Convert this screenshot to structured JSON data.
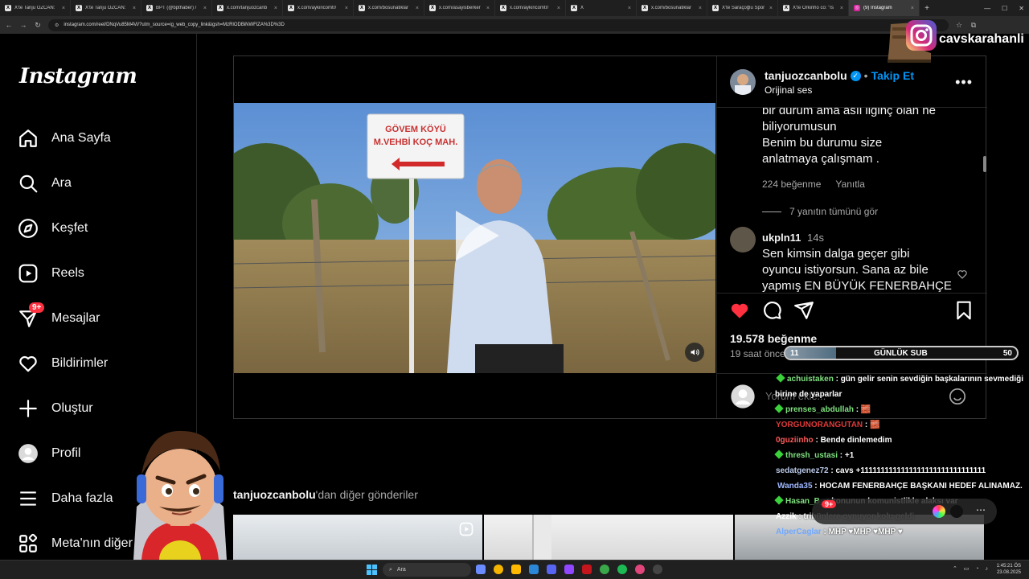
{
  "browser": {
    "tabs": [
      {
        "label": "X'te Tanju ÖZCAN:",
        "icon": "x-logo-icon"
      },
      {
        "label": "X'te Tanju ÖZCAN:",
        "icon": "x-logo-icon"
      },
      {
        "label": "BPT (@bpthaber) /",
        "icon": "x-logo-icon"
      },
      {
        "label": "x.com/tanjuozcanb",
        "icon": "x-logo-icon"
      },
      {
        "label": "x.com/aykiricomtr/",
        "icon": "x-logo-icon"
      },
      {
        "label": "x.com/bosunatiklar",
        "icon": "x-logo-icon"
      },
      {
        "label": "x.com/asayisberker",
        "icon": "x-logo-icon"
      },
      {
        "label": "x.com/aykiricomtr/",
        "icon": "x-logo-icon"
      },
      {
        "label": "X",
        "icon": "x-logo-icon"
      },
      {
        "label": "x.com/bosunatiklar",
        "icon": "x-logo-icon"
      },
      {
        "label": "X'te Saraçoğlu Spor",
        "icon": "x-logo-icon"
      },
      {
        "label": "X'te Orkinho co: \"Is",
        "icon": "x-logo-icon"
      },
      {
        "label": "(9) Instagram",
        "icon": "instagram-icon",
        "active": true
      }
    ],
    "url": "instagram.com/reel/DNqVu85M4Vi/?utm_source=ig_web_copy_link&igsh=MzRlODBiNWFlZA%3D%3D"
  },
  "sidebar": {
    "logo": "Instagram",
    "items": [
      {
        "label": "Ana Sayfa",
        "icon": "home-icon"
      },
      {
        "label": "Ara",
        "icon": "search-icon"
      },
      {
        "label": "Keşfet",
        "icon": "compass-icon"
      },
      {
        "label": "Reels",
        "icon": "reels-icon"
      },
      {
        "label": "Mesajlar",
        "icon": "messenger-icon",
        "badge": "9+"
      },
      {
        "label": "Bildirimler",
        "icon": "heart-icon"
      },
      {
        "label": "Oluştur",
        "icon": "plus-icon"
      },
      {
        "label": "Profil",
        "icon": "profile-icon"
      },
      {
        "label": "Daha fazla",
        "icon": "menu-icon"
      },
      {
        "label": "Meta'nın diğer",
        "icon": "meta-apps-icon"
      }
    ]
  },
  "video": {
    "sign_line1": "GÖVEM KÖYÜ",
    "sign_line2": "M.VEHBİ KOÇ MAH."
  },
  "post": {
    "username": "tanjuozcanbolu",
    "follow_label": "Takip Et",
    "audio": "Orijinal ses",
    "comment1_lines": [
      "bir durum ama asıl ilginç olan ne",
      "biliyorumusun",
      "Benim bu durumu size",
      "anlatmaya çalışmam ."
    ],
    "comment1_likes": "224 beğenme",
    "comment1_reply": "Yanıtla",
    "comment1_view_replies": "7 yanıtın tümünü gör",
    "comment2_user": "ukpln11",
    "comment2_time": "14s",
    "comment2_lines": [
      "Sen kimsin dalga geçer gibi",
      "oyuncu istiyorsun. Sana az bile",
      "yapmış EN BÜYÜK FENERBAHÇE"
    ],
    "likes": "19.578 beğenme",
    "time_ago": "19 saat önce",
    "comment_placeholder": "Yorum ekle..."
  },
  "more_posts": {
    "user": "tanjuozcanbolu",
    "suffix": "'dan diğer gönderiler"
  },
  "stream": {
    "channel_name": "cavskarahanli",
    "sub_goal": {
      "current": "11",
      "label": "GÜNLÜK SUB",
      "target": "50",
      "progress": 0.22
    },
    "chat": [
      {
        "user": "achuistaken",
        "color": "#7fe07f",
        "gem": true,
        "text": "gün gelir senin sevdiğin başkalarının sevmediği birine de yaparlar"
      },
      {
        "user": "prenses_abdullah",
        "color": "#7fe07f",
        "gem": true,
        "text": "🧱"
      },
      {
        "user": "YORGUNORANGUTAN",
        "color": "#e03a3a",
        "gem": false,
        "text": "🧱"
      },
      {
        "user": "0guziinho",
        "color": "#ff5a5a",
        "gem": false,
        "text": "Bende dinlemedim"
      },
      {
        "user": "thresh_ustasi",
        "color": "#7fe07f",
        "gem": true,
        "text": "+1"
      },
      {
        "user": "sedatgenez72",
        "color": "#b8c8e8",
        "gem": false,
        "text": "cavs +1111111111111111111111111111111"
      },
      {
        "user": "Wanda35",
        "color": "#9fb8ff",
        "gem": false,
        "text": "HOCAM FENERBAHÇE BAŞKANI HEDEF ALINAMAZ."
      },
      {
        "user": "Hasan_B_",
        "color": "#7fe07f",
        "gem": true,
        "text": "konunun komunistlikle alaksı var"
      },
      {
        "user": "Azzik",
        "color": "#ffffff",
        "gem": false,
        "text": "tribünlere oynuyor kolu geldi"
      },
      {
        "user": "AlperCaglar",
        "color": "#6fa8ff",
        "gem": false,
        "text": "MHP ♥MHP ♥MHP ♥"
      }
    ],
    "chat_badge": "9+"
  },
  "taskbar": {
    "search_label": "Ara",
    "time": "1:45:21 ÖS",
    "date": "23.08.2025"
  },
  "colors": {
    "accent_blue": "#0095f6",
    "like_red": "#ff3040",
    "instagram_pink": "#d6249f"
  }
}
